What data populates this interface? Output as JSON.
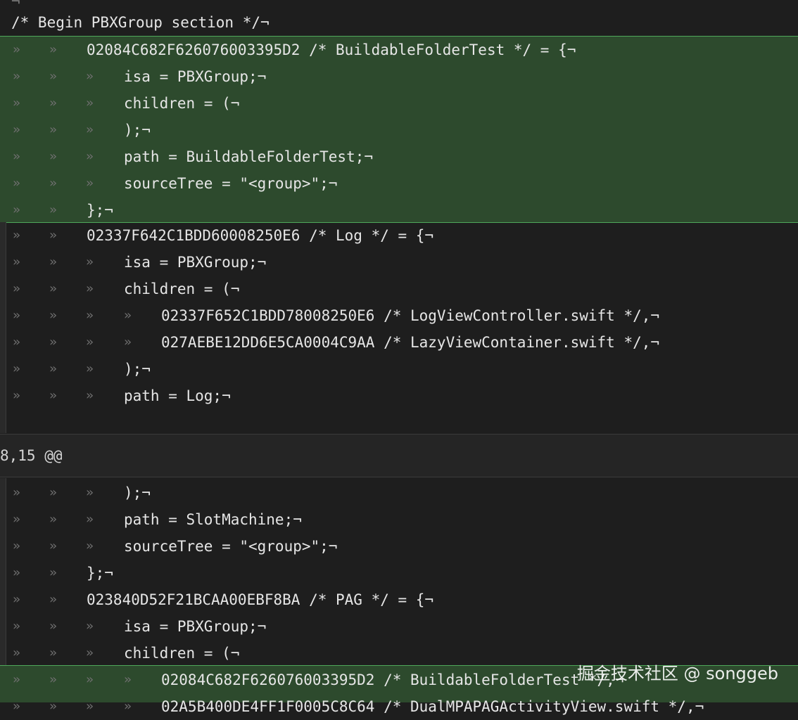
{
  "top_fragment": "¬",
  "section_header": "/* Begin PBXGroup section */¬",
  "tab_glyph": "»",
  "lines_a": [
    {
      "indent": 2,
      "text": "02084C682F626076003395D2 /* BuildableFolderTest */ = {¬"
    },
    {
      "indent": 3,
      "text": "isa = PBXGroup;¬"
    },
    {
      "indent": 3,
      "text": "children = (¬"
    },
    {
      "indent": 3,
      "text": ");¬"
    },
    {
      "indent": 3,
      "text": "path = BuildableFolderTest;¬"
    },
    {
      "indent": 3,
      "text": "sourceTree = \"<group>\";¬"
    },
    {
      "indent": 2,
      "text": "};¬"
    }
  ],
  "lines_b": [
    {
      "indent": 2,
      "text": "02337F642C1BDD60008250E6 /* Log */ = {¬"
    },
    {
      "indent": 3,
      "text": "isa = PBXGroup;¬"
    },
    {
      "indent": 3,
      "text": "children = (¬"
    },
    {
      "indent": 4,
      "text": "02337F652C1BDD78008250E6 /* LogViewController.swift */,¬"
    },
    {
      "indent": 4,
      "text": "027AEBE12DD6E5CA0004C9AA /* LazyViewContainer.swift */,¬"
    },
    {
      "indent": 3,
      "text": ");¬"
    },
    {
      "indent": 3,
      "text": "path = Log;¬"
    }
  ],
  "hunk_header": "8,15 @@",
  "lines_c": [
    {
      "indent": 3,
      "text": ");¬"
    },
    {
      "indent": 3,
      "text": "path = SlotMachine;¬"
    },
    {
      "indent": 3,
      "text": "sourceTree = \"<group>\";¬"
    },
    {
      "indent": 2,
      "text": "};¬"
    },
    {
      "indent": 2,
      "text": "023840D52F21BCAA00EBF8BA /* PAG */ = {¬"
    },
    {
      "indent": 3,
      "text": "isa = PBXGroup;¬"
    },
    {
      "indent": 3,
      "text": "children = (¬"
    }
  ],
  "lines_d": [
    {
      "indent": 4,
      "text": "02084C682F626076003395D2 /* BuildableFolderTest */,¬"
    },
    {
      "indent": 4,
      "text": "02A5B400DE4FF1F0005C8C64 /* DualMPAPAGActivityView.swift */,¬"
    }
  ],
  "watermark": "掘金技术社区 @ songgeb",
  "colors": {
    "added_bg": "#2d4a2d",
    "added_border": "#4fa85a",
    "editor_bg": "#1e1e1e"
  }
}
